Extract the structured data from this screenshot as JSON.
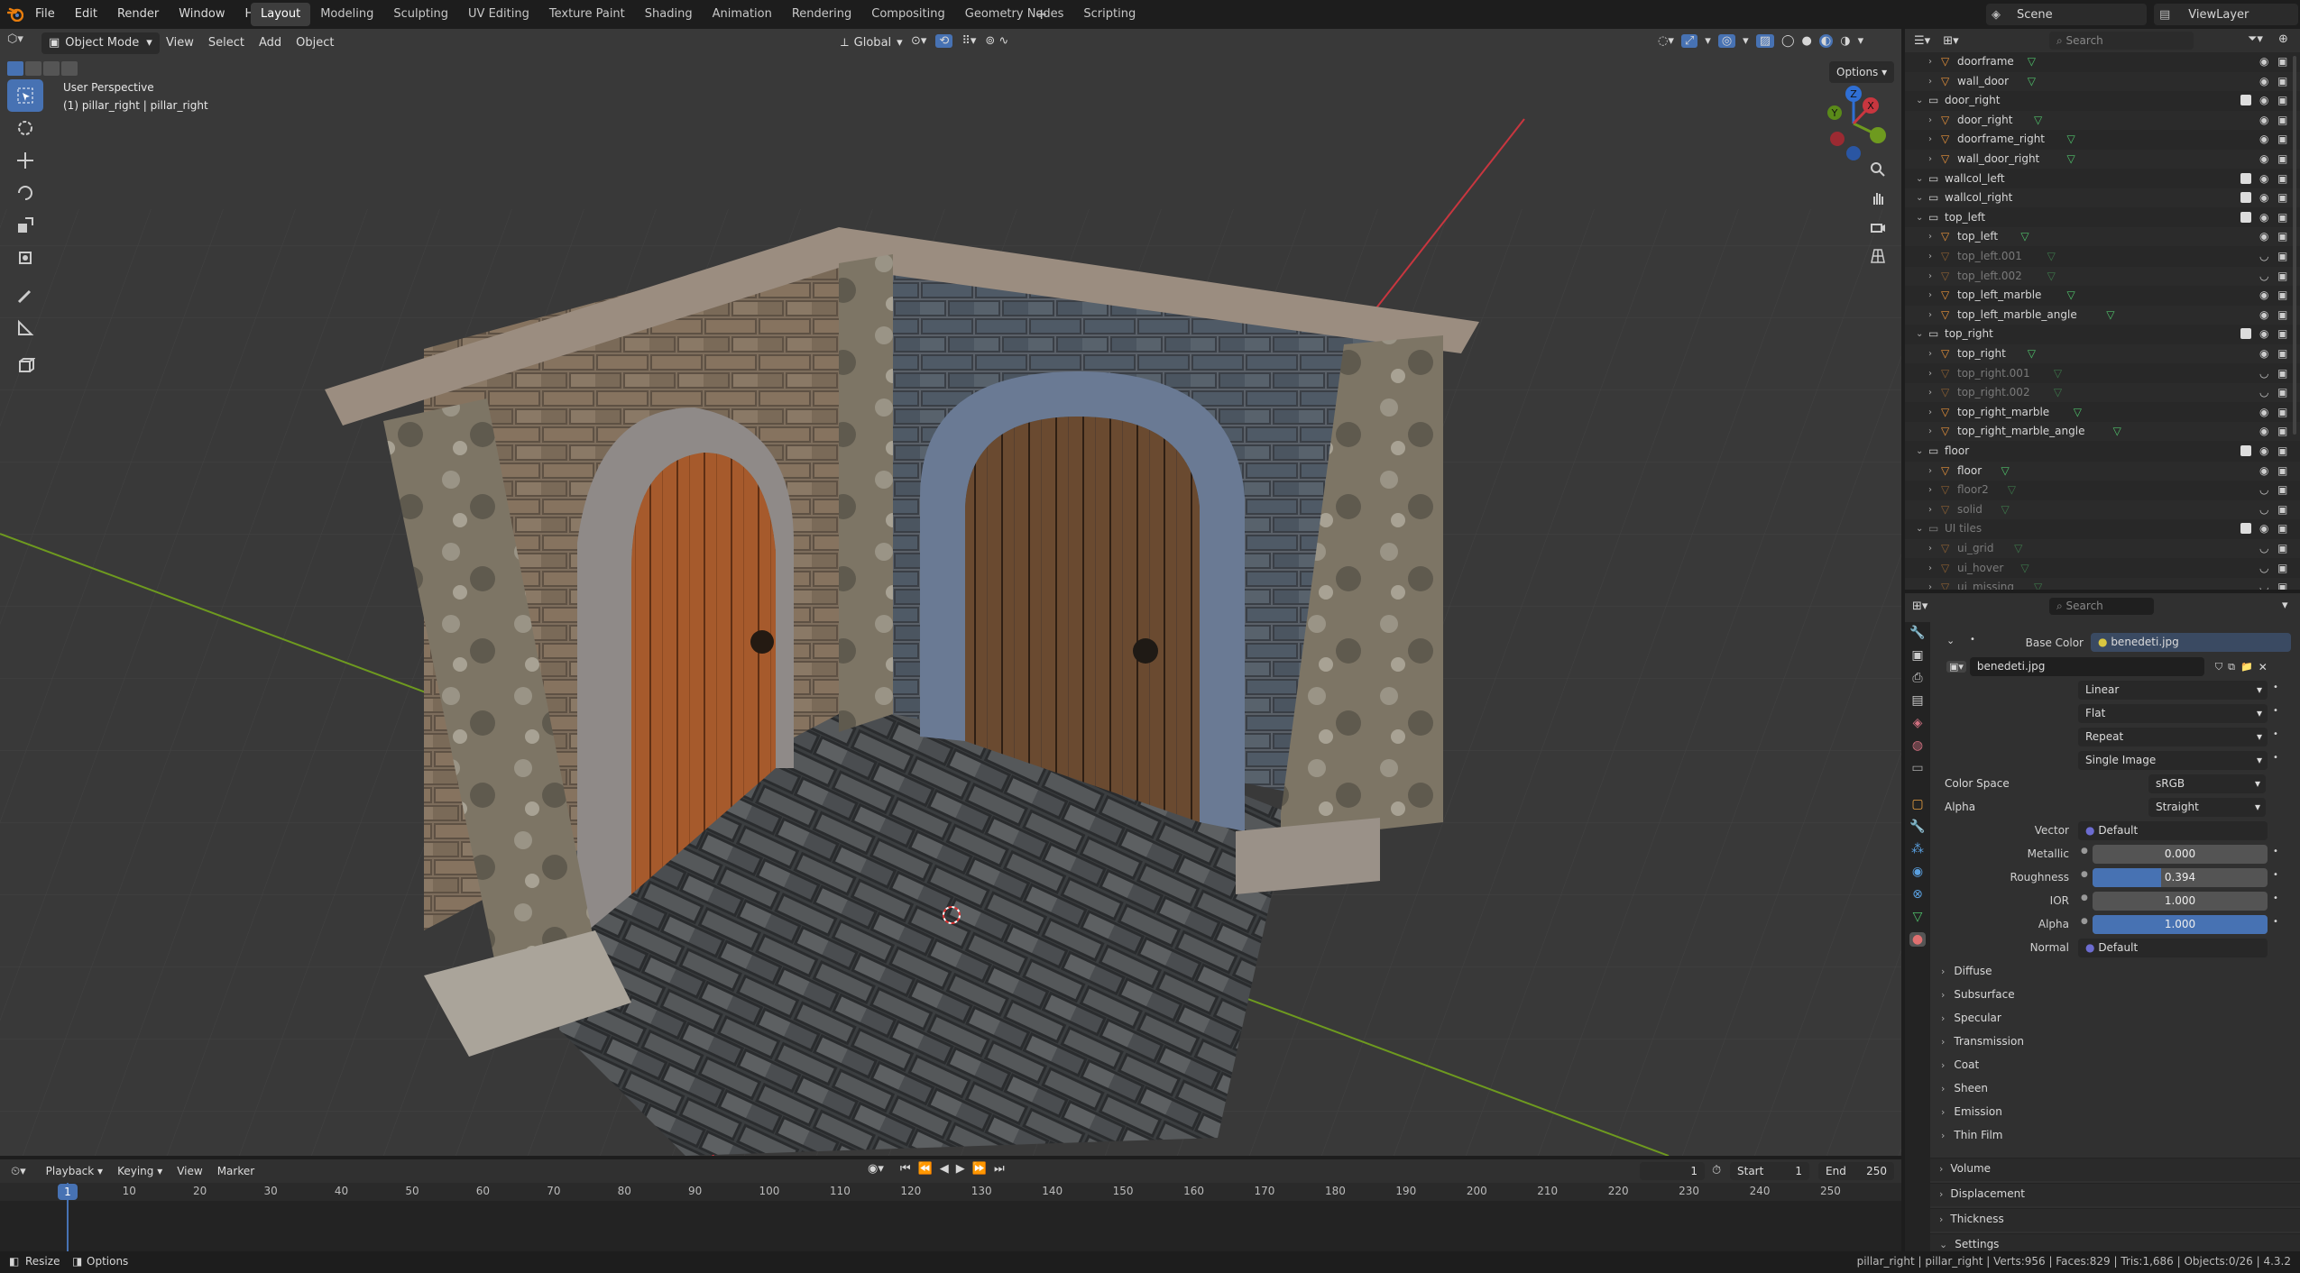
{
  "menu": [
    "File",
    "Edit",
    "Render",
    "Window",
    "Help"
  ],
  "workspaces": [
    "Layout",
    "Modeling",
    "Sculpting",
    "UV Editing",
    "Texture Paint",
    "Shading",
    "Animation",
    "Rendering",
    "Compositing",
    "Geometry Nodes",
    "Scripting"
  ],
  "active_workspace": "Layout",
  "scene": "Scene",
  "view_layer": "ViewLayer",
  "viewport": {
    "mode": "Object Mode",
    "menus": [
      "View",
      "Select",
      "Add",
      "Object"
    ],
    "transform": "Global",
    "options": "Options",
    "overlay_title": "User Perspective",
    "overlay_object": "(1) pillar_right | pillar_right",
    "gizmo": {
      "x": "X",
      "y": "Y",
      "z": "Z"
    }
  },
  "outliner": {
    "search_placeholder": "Search",
    "rows": [
      {
        "name": "doorframe",
        "level": 2,
        "dim": false
      },
      {
        "name": "wall_door",
        "level": 2,
        "dim": false
      },
      {
        "name": "door_right",
        "level": 1,
        "dim": false
      },
      {
        "name": "door_right",
        "level": 2,
        "dim": false
      },
      {
        "name": "doorframe_right",
        "level": 2,
        "dim": false
      },
      {
        "name": "wall_door_right",
        "level": 2,
        "dim": false
      },
      {
        "name": "wallcol_left",
        "level": 1,
        "dim": false
      },
      {
        "name": "wallcol_right",
        "level": 1,
        "dim": false
      },
      {
        "name": "top_left",
        "level": 1,
        "dim": false
      },
      {
        "name": "top_left",
        "level": 2,
        "dim": false
      },
      {
        "name": "top_left.001",
        "level": 2,
        "dim": true
      },
      {
        "name": "top_left.002",
        "level": 2,
        "dim": true
      },
      {
        "name": "top_left_marble",
        "level": 2,
        "dim": false
      },
      {
        "name": "top_left_marble_angle",
        "level": 2,
        "dim": false
      },
      {
        "name": "top_right",
        "level": 1,
        "dim": false
      },
      {
        "name": "top_right",
        "level": 2,
        "dim": false
      },
      {
        "name": "top_right.001",
        "level": 2,
        "dim": true
      },
      {
        "name": "top_right.002",
        "level": 2,
        "dim": true
      },
      {
        "name": "top_right_marble",
        "level": 2,
        "dim": false
      },
      {
        "name": "top_right_marble_angle",
        "level": 2,
        "dim": false
      },
      {
        "name": "floor",
        "level": 1,
        "dim": false
      },
      {
        "name": "floor",
        "level": 2,
        "dim": false
      },
      {
        "name": "floor2",
        "level": 2,
        "dim": true
      },
      {
        "name": "solid",
        "level": 2,
        "dim": true
      },
      {
        "name": "UI tiles",
        "level": 1,
        "dim": true
      },
      {
        "name": "ui_grid",
        "level": 2,
        "dim": true
      },
      {
        "name": "ui_hover",
        "level": 2,
        "dim": true
      },
      {
        "name": "ui_missing",
        "level": 2,
        "dim": true
      }
    ]
  },
  "properties": {
    "search_placeholder": "Search",
    "base_color_label": "Base Color",
    "base_color_value": "benedeti.jpg",
    "image_name": "benedeti.jpg",
    "interpolation": "Linear",
    "projection": "Flat",
    "extension": "Repeat",
    "source": "Single Image",
    "color_space_label": "Color Space",
    "color_space": "sRGB",
    "alpha_mode_label": "Alpha",
    "alpha_mode": "Straight",
    "vector_label": "Vector",
    "vector_value": "Default",
    "metallic_label": "Metallic",
    "metallic": 0.0,
    "metallic_text": "0.000",
    "roughness_label": "Roughness",
    "roughness": 0.394,
    "roughness_text": "0.394",
    "ior_label": "IOR",
    "ior_text": "1.000",
    "alpha_label": "Alpha",
    "alpha": 1.0,
    "alpha_text": "1.000",
    "normal_label": "Normal",
    "normal_value": "Default",
    "subsections": [
      "Diffuse",
      "Subsurface",
      "Specular",
      "Transmission",
      "Coat",
      "Sheen",
      "Emission",
      "Thin Film"
    ],
    "panels": [
      "Volume",
      "Displacement",
      "Thickness",
      "Settings"
    ]
  },
  "timeline": {
    "menus": [
      "Playback",
      "Keying",
      "View",
      "Marker"
    ],
    "current_frame": "1",
    "start_label": "Start",
    "start": "1",
    "end_label": "End",
    "end": "250",
    "ticks": [
      "1",
      "10",
      "20",
      "30",
      "40",
      "50",
      "60",
      "70",
      "80",
      "90",
      "100",
      "110",
      "120",
      "130",
      "140",
      "150",
      "160",
      "170",
      "180",
      "190",
      "200",
      "210",
      "220",
      "230",
      "240",
      "250"
    ]
  },
  "status": {
    "left1": "Resize",
    "left2": "Options",
    "right": "pillar_right | pillar_right | Verts:956 | Faces:829 | Tris:1,686 | Objects:0/26 | 4.3.2"
  },
  "colors": {
    "accent": "#4772b3",
    "x_axis": "#c8363f",
    "y_axis": "#6e9a1f",
    "z_axis": "#2f6fd4"
  }
}
